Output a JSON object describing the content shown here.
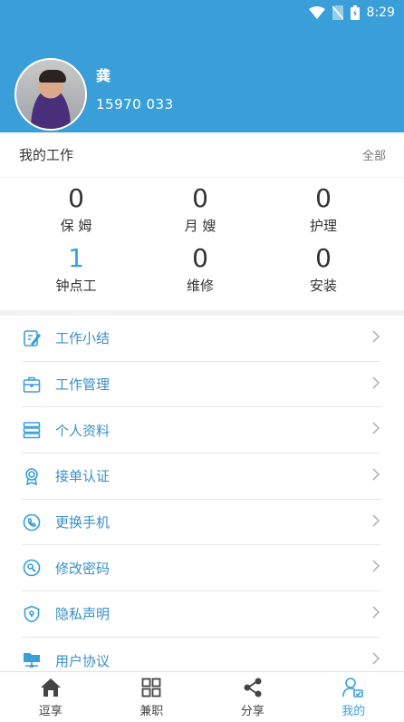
{
  "status_bar": {
    "time": "8:29"
  },
  "user": {
    "name": "龚",
    "phone": "15970    033"
  },
  "work": {
    "title": "我的工作",
    "all_link": "全部",
    "stats": [
      {
        "count": "0",
        "label": "保 姆"
      },
      {
        "count": "0",
        "label": "月 嫂"
      },
      {
        "count": "0",
        "label": "护理"
      },
      {
        "count": "1",
        "label": "钟点工"
      },
      {
        "count": "0",
        "label": "维修"
      },
      {
        "count": "0",
        "label": "安装"
      }
    ]
  },
  "menu": [
    {
      "label": "工作小结",
      "icon": "edit-note-icon"
    },
    {
      "label": "工作管理",
      "icon": "briefcase-icon"
    },
    {
      "label": "个人资料",
      "icon": "server-stack-icon"
    },
    {
      "label": "接单认证",
      "icon": "badge-icon"
    },
    {
      "label": "更换手机",
      "icon": "phone-call-icon"
    },
    {
      "label": "修改密码",
      "icon": "lock-ring-icon"
    },
    {
      "label": "隐私声明",
      "icon": "shield-icon"
    },
    {
      "label": "用户协议",
      "icon": "folder-network-icon"
    }
  ],
  "tabs": [
    {
      "label": "逗享",
      "icon": "home-icon"
    },
    {
      "label": "兼职",
      "icon": "grid-icon"
    },
    {
      "label": "分享",
      "icon": "share-icon"
    },
    {
      "label": "我的",
      "icon": "profile-icon"
    }
  ],
  "colors": {
    "brand": "#3a9fd8",
    "accent_text": "#3a8fc8"
  }
}
